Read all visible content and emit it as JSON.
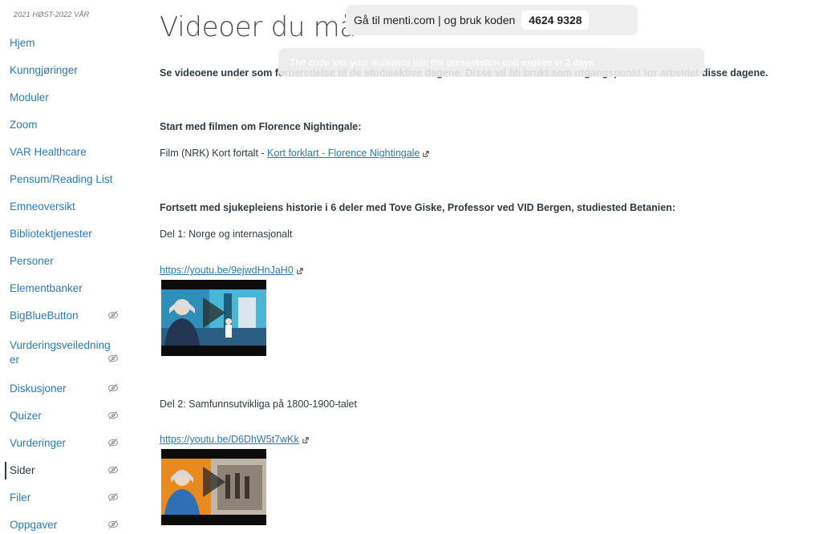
{
  "sidebar": {
    "term": "2021 HØST-2022 VÅR",
    "items": [
      {
        "label": "Hjem",
        "hidden": false,
        "active": false
      },
      {
        "label": "Kunngjøringer",
        "hidden": false,
        "active": false
      },
      {
        "label": "Moduler",
        "hidden": false,
        "active": false
      },
      {
        "label": "Zoom",
        "hidden": false,
        "active": false
      },
      {
        "label": "VAR Healthcare",
        "hidden": false,
        "active": false
      },
      {
        "label": "Pensum/Reading List",
        "hidden": false,
        "active": false
      },
      {
        "label": "Emneoversikt",
        "hidden": false,
        "active": false
      },
      {
        "label": "Bibliotektjenester",
        "hidden": false,
        "active": false
      },
      {
        "label": "Personer",
        "hidden": false,
        "active": false
      },
      {
        "label": "Elementbanker",
        "hidden": false,
        "active": false
      },
      {
        "label": "BigBlueButton",
        "hidden": true,
        "active": false
      },
      {
        "label": "Vurderingsveiledning",
        "label_line2": "er",
        "hidden": true,
        "active": false
      },
      {
        "label": "Diskusjoner",
        "hidden": true,
        "active": false
      },
      {
        "label": "Quizer",
        "hidden": true,
        "active": false
      },
      {
        "label": "Vurderinger",
        "hidden": true,
        "active": false
      },
      {
        "label": "Sider",
        "hidden": true,
        "active": true
      },
      {
        "label": "Filer",
        "hidden": true,
        "active": false
      },
      {
        "label": "Oppgaver",
        "hidden": true,
        "active": false
      }
    ]
  },
  "menti": {
    "text": "Gå til menti.com | og bruk koden",
    "code": "4624 9328",
    "subtext": "The code lets your audience join the presentation and expires in 2 days"
  },
  "page": {
    "title": "Videoer du må",
    "intro": "Se videoene under som forberedelse til de studieaktive dagene. Disse vil bli brukt som utgangspunkt for arbeidet disse dagene.",
    "start_heading": "Start med filmen om Florence Nightingale:",
    "film_prefix": "Film (NRK) Kort fortalt - ",
    "film_link": "Kort forklart - Florence Nightingale",
    "continue_heading": "Fortsett med sjukepleiens historie i 6 deler med Tove Giske, Professor ved VID Bergen, studiested Betanien:",
    "parts": [
      {
        "label": "Del 1: Norge og internasjonalt",
        "link": "https://youtu.be/9ejwdHnJaH0"
      },
      {
        "label": "Del 2: Samfunnsutvikliga på 1800-1900-talet",
        "link": "https://youtu.be/D6DhW5t7wKk"
      }
    ]
  },
  "colors": {
    "link": "#2a7ab9",
    "text": "#2d3b45"
  }
}
